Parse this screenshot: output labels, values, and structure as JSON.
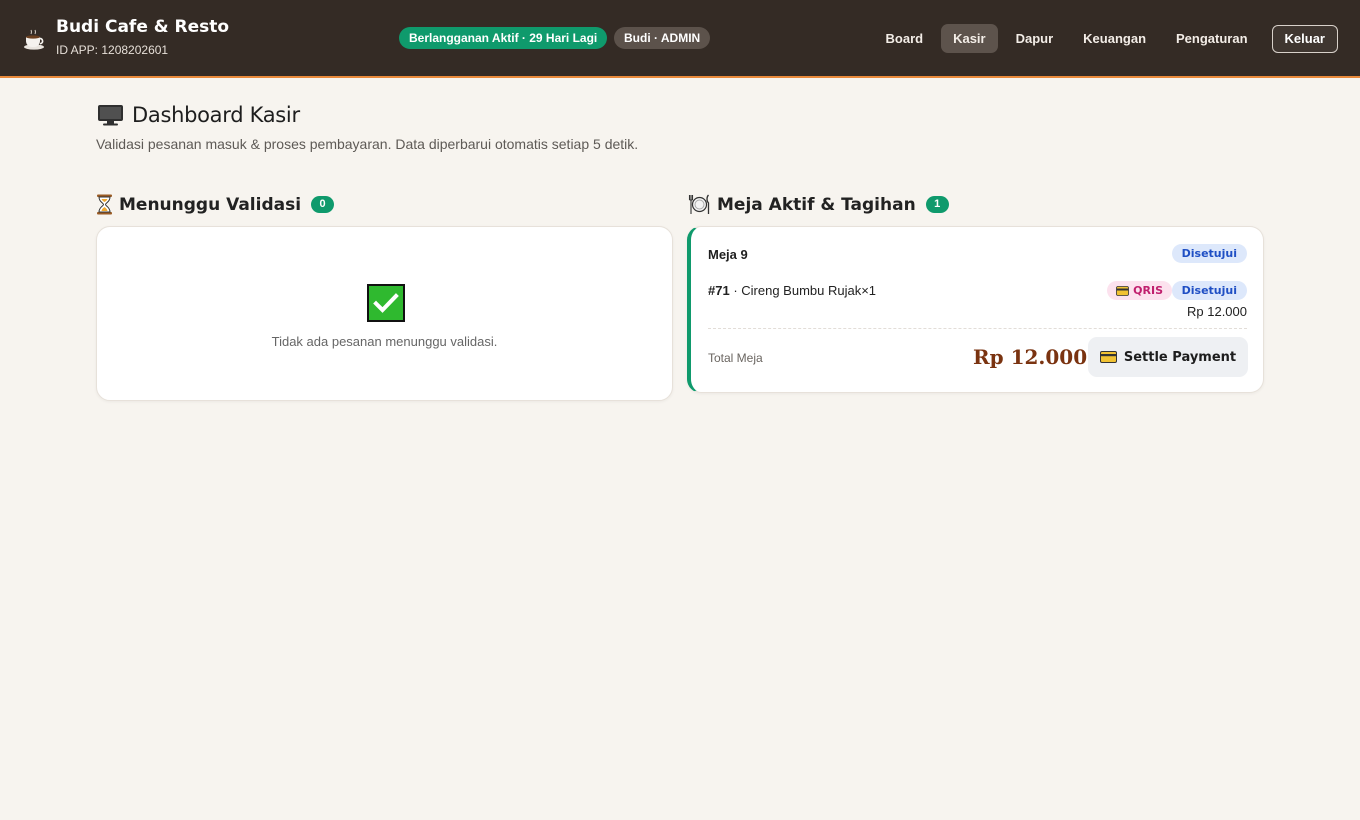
{
  "header": {
    "app_name": "Budi Cafe & Resto",
    "app_id": "ID APP: 1208202601",
    "subscription": "Berlangganan Aktif · 29 Hari Lagi",
    "user": "Budi · ADMIN",
    "icons": {
      "brand": "coffee-cup-icon"
    },
    "nav": [
      {
        "label": "Board",
        "active": false
      },
      {
        "label": "Kasir",
        "active": true
      },
      {
        "label": "Dapur",
        "active": false
      },
      {
        "label": "Keuangan",
        "active": false
      },
      {
        "label": "Pengaturan",
        "active": false
      }
    ],
    "logout_label": "Keluar"
  },
  "page": {
    "title": "Dashboard Kasir",
    "subtitle": "Validasi pesanan masuk & proses pembayaran. Data diperbarui otomatis setiap 5 detik.",
    "icon": "monitor-icon"
  },
  "pending": {
    "title": "Menunggu Validasi",
    "count": "0",
    "icon": "hourglass-icon",
    "empty_text": "Tidak ada pesanan menunggu validasi.",
    "empty_icon": "check-mark-icon"
  },
  "active_tables": {
    "title": "Meja Aktif & Tagihan",
    "count": "1",
    "icon": "plate-cutlery-icon",
    "table": {
      "name": "Meja 9",
      "status": "Disetujui",
      "order_id": "#71",
      "order_items": " · Cireng Bumbu Rujak×1",
      "payment_method": "QRIS",
      "order_status": "Disetujui",
      "order_price": "Rp 12.000",
      "total_label": "Total Meja",
      "total_value": "Rp 12.000",
      "settle_label": "Settle Payment"
    }
  },
  "colors": {
    "header_bg": "#342b25",
    "accent_orange": "#e8893a",
    "green": "#0f9a6c",
    "total_brown": "#7a3310",
    "badge_blue": "#1f4fc4",
    "badge_pink": "#c0206e",
    "page_bg": "#f7f4ef"
  }
}
